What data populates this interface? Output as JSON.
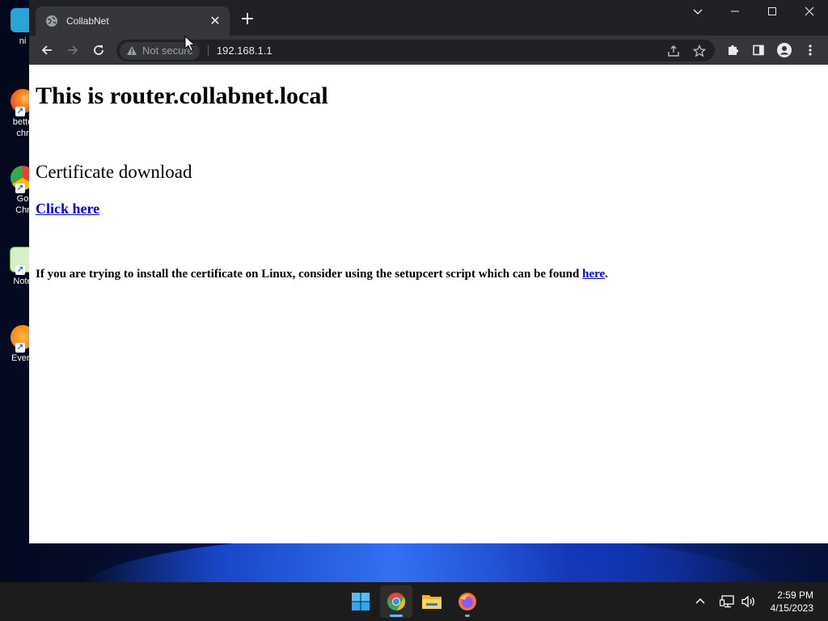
{
  "desktop": {
    "icons": [
      {
        "label": "ni",
        "icon": "file-icon"
      },
      {
        "label": "bette\nchr",
        "icon": "firefox-icon"
      },
      {
        "label": "Go\nChr",
        "icon": "chrome-icon"
      },
      {
        "label": "Note",
        "icon": "notepad-icon"
      },
      {
        "label": "Every",
        "icon": "everything-icon"
      }
    ]
  },
  "browser": {
    "tab": {
      "title": "CollabNet",
      "favicon": "globe-icon"
    },
    "window_controls": {
      "tab_search": "chevron-down-icon",
      "minimize": "minimize-icon",
      "maximize": "maximize-icon",
      "close": "close-icon"
    },
    "address": {
      "security_label": "Not secure",
      "url": "192.168.1.1"
    }
  },
  "page": {
    "heading": "This is router.collabnet.local",
    "subheading": "Certificate download",
    "download_link": "Click here",
    "note_text": "If you are trying to install the certificate on Linux, consider using the setupcert script which can be found ",
    "note_link": "here",
    "note_end": "."
  },
  "taskbar": {
    "apps": [
      "windows-start-icon",
      "chrome-icon",
      "file-explorer-icon",
      "firefox-icon"
    ],
    "time": "2:59 PM",
    "date": "4/15/2023"
  },
  "colors": {
    "link": "#0000ee",
    "chrome_dark": "#202124",
    "chrome_toolbar": "#35363a",
    "taskbar": "#1c1c1c"
  }
}
